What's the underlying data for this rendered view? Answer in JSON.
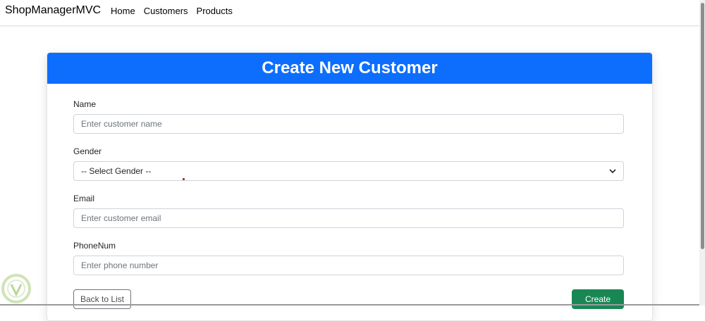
{
  "navbar": {
    "brand": "ShopManagerMVC",
    "links": [
      "Home",
      "Customers",
      "Products"
    ]
  },
  "form": {
    "title": "Create New Customer",
    "fields": [
      {
        "label": "Name",
        "placeholder": "Enter customer name"
      },
      {
        "label": "Gender",
        "selected": "-- Select Gender --"
      },
      {
        "label": "Email",
        "placeholder": "Enter customer email"
      },
      {
        "label": "PhoneNum",
        "placeholder": "Enter phone number"
      }
    ],
    "back_label": "Back to List",
    "create_label": "Create"
  },
  "colors": {
    "header": "#0d6efd",
    "create_button": "#198754"
  },
  "icons": [
    "chevron-down-icon",
    "watermark-logo-icon"
  ]
}
